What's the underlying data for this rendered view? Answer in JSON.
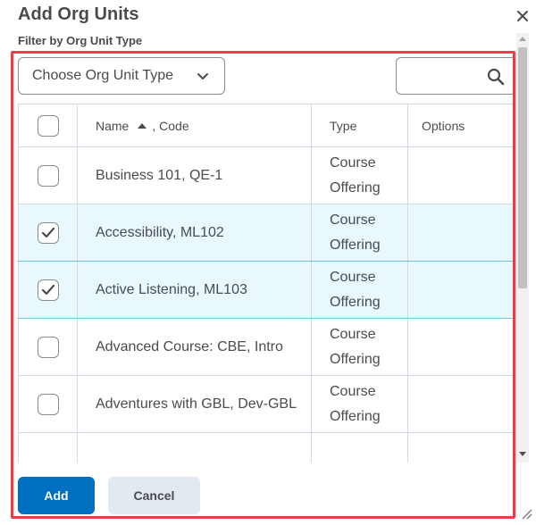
{
  "dialog": {
    "title": "Add Org Units",
    "filter_label": "Filter by Org Unit Type"
  },
  "filter": {
    "type_select_label": "Choose Org Unit Type",
    "search_value": "",
    "search_placeholder": ""
  },
  "table": {
    "headers": {
      "name": "Name",
      "code": ", Code",
      "type": "Type",
      "options": "Options"
    },
    "sort": "name-ascending",
    "rows": [
      {
        "name": "Business 101, QE-1",
        "type_line1": "Course",
        "type_line2": "Offering",
        "checked": false
      },
      {
        "name": "Accessibility, ML102",
        "type_line1": "Course",
        "type_line2": "Offering",
        "checked": true
      },
      {
        "name": "Active Listening, ML103",
        "type_line1": "Course",
        "type_line2": "Offering",
        "checked": true
      },
      {
        "name": "Advanced Course: CBE, Intro",
        "type_line1": "Course",
        "type_line2": "Offering",
        "checked": false
      },
      {
        "name": "Adventures with GBL, Dev-GBL",
        "type_line1": "Course",
        "type_line2": "Offering",
        "checked": false
      }
    ]
  },
  "buttons": {
    "add": "Add",
    "cancel": "Cancel"
  },
  "colors": {
    "primary": "#006fbf",
    "selected_row": "#e8f8fd",
    "highlight_frame": "#e5404a"
  }
}
